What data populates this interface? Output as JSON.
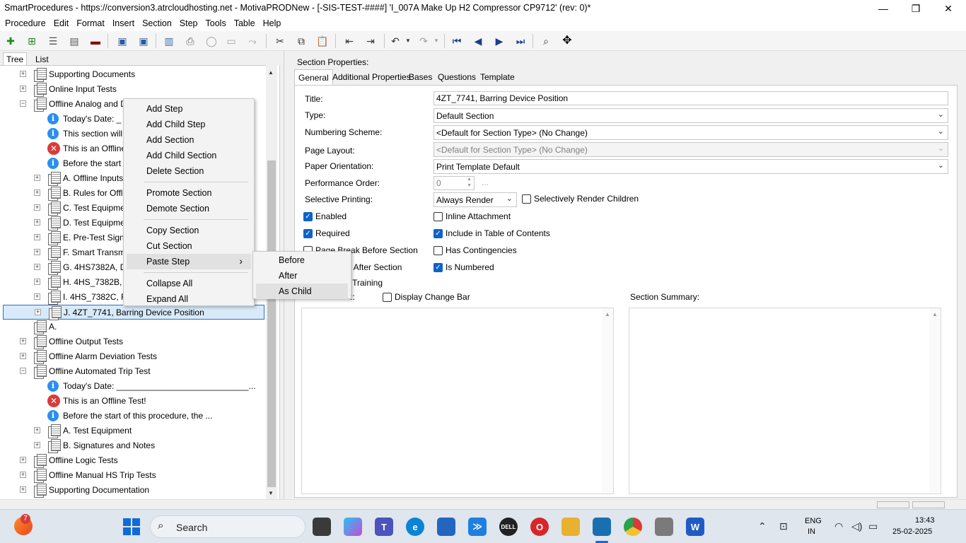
{
  "window": {
    "title": "SmartProcedures - https://conversion3.atrcloudhosting.net - MotivaPRODNew - [-SIS-TEST-####] 'I_007A Make Up H2 Compressor CP9712' (rev: 0)*",
    "minimize": "—",
    "maximize": "❐",
    "close": "✕"
  },
  "menu": [
    "Procedure",
    "Edit",
    "Format",
    "Insert",
    "Section",
    "Step",
    "Tools",
    "Table",
    "Help"
  ],
  "left_tabs": [
    "Tree",
    "List"
  ],
  "tree": [
    {
      "label": "Supporting Documents",
      "kind": "doc",
      "exp": "+",
      "indent": 0
    },
    {
      "label": "Online Input Tests",
      "kind": "doc",
      "exp": "+",
      "indent": 0
    },
    {
      "label": "Offline Analog and D",
      "kind": "doc",
      "exp": "−",
      "indent": 0
    },
    {
      "label": "Today's Date: _",
      "kind": "info",
      "exp": "",
      "indent": 1
    },
    {
      "label": "This section will b",
      "kind": "info",
      "exp": "",
      "indent": 1
    },
    {
      "label": "This is an Offline",
      "kind": "error",
      "exp": "",
      "indent": 1
    },
    {
      "label": "Before the start",
      "kind": "info",
      "exp": "",
      "indent": 1
    },
    {
      "label": "A. Offline Inputs",
      "kind": "doc",
      "exp": "+",
      "indent": 1
    },
    {
      "label": "B. Rules for Offli",
      "kind": "doc",
      "exp": "+",
      "indent": 1
    },
    {
      "label": "C. Test Equipme",
      "kind": "doc",
      "exp": "+",
      "indent": 1
    },
    {
      "label": "D. Test Equipme",
      "kind": "doc",
      "exp": "+",
      "indent": 1
    },
    {
      "label": "E. Pre-Test Sign",
      "kind": "doc",
      "exp": "+",
      "indent": 1
    },
    {
      "label": "F. Smart Transm",
      "kind": "doc",
      "exp": "+",
      "indent": 1
    },
    {
      "label": "G. 4HS7382A, D",
      "kind": "doc",
      "exp": "+",
      "indent": 1
    },
    {
      "label": "H. 4HS_7382B, (",
      "kind": "doc",
      "exp": "+",
      "indent": 1
    },
    {
      "label": "I. 4HS_7382C, F",
      "kind": "doc",
      "exp": "+",
      "indent": 1
    },
    {
      "label": "J. 4ZT_7741, Barring Device Position",
      "kind": "doc",
      "exp": "+",
      "indent": 1,
      "selected": true
    },
    {
      "label": "A.",
      "kind": "doc",
      "exp": "",
      "indent": 0
    },
    {
      "label": "Offline Output Tests",
      "kind": "doc",
      "exp": "+",
      "indent": 0
    },
    {
      "label": "Offline Alarm Deviation Tests",
      "kind": "doc",
      "exp": "+",
      "indent": 0
    },
    {
      "label": "Offline Automated Trip Test",
      "kind": "doc",
      "exp": "−",
      "indent": 0
    },
    {
      "label": "Today's Date: ____________________________...",
      "kind": "info",
      "exp": "",
      "indent": 1
    },
    {
      "label": "This is an Offline Test!",
      "kind": "error",
      "exp": "",
      "indent": 1
    },
    {
      "label": "Before the start of this procedure, the ...",
      "kind": "info",
      "exp": "",
      "indent": 1
    },
    {
      "label": "A. Test Equipment",
      "kind": "doc",
      "exp": "+",
      "indent": 1
    },
    {
      "label": "B. Signatures and Notes",
      "kind": "doc",
      "exp": "+",
      "indent": 1
    },
    {
      "label": "Offline Logic Tests",
      "kind": "doc",
      "exp": "+",
      "indent": 0
    },
    {
      "label": "Offline Manual HS Trip Tests",
      "kind": "doc",
      "exp": "+",
      "indent": 0
    },
    {
      "label": "Supporting Documentation",
      "kind": "doc",
      "exp": "+",
      "indent": 0
    }
  ],
  "context_menu": {
    "items": [
      {
        "label": "Add Step"
      },
      {
        "label": "Add Child Step"
      },
      {
        "label": "Add Section"
      },
      {
        "label": "Add Child Section"
      },
      {
        "label": "Delete Section"
      },
      {
        "sep": true
      },
      {
        "label": "Promote Section"
      },
      {
        "label": "Demote Section"
      },
      {
        "sep": true
      },
      {
        "label": "Copy Section"
      },
      {
        "label": "Cut Section"
      },
      {
        "label": "Paste Step",
        "submenu": true,
        "highlighted": true
      },
      {
        "sep": true
      },
      {
        "label": "Collapse All"
      },
      {
        "label": "Expand All"
      }
    ],
    "submenu_arrow": "›",
    "submenu": [
      {
        "label": "Before"
      },
      {
        "label": "After"
      },
      {
        "label": "As Child",
        "highlighted": true
      }
    ]
  },
  "section_properties": {
    "heading": "Section Properties:",
    "tabs": [
      "General",
      "Additional Properties",
      "Bases",
      "Questions",
      "Template"
    ],
    "title_label": "Title:",
    "title_value": "4ZT_7741, Barring Device Position",
    "type_label": "Type:",
    "type_value": "Default Section",
    "numbering_label": "Numbering Scheme:",
    "numbering_value": "<Default for Section Type> (No Change)",
    "layout_label": "Page Layout:",
    "layout_value": "<Default for Section Type> (No Change)",
    "orientation_label": "Paper Orientation:",
    "orientation_value": "Print Template Default",
    "perf_label": "Performance Order:",
    "perf_value": "0",
    "perf_btn": "...",
    "selective_label": "Selective Printing:",
    "selective_value": "Always Render",
    "selective_children": "Selectively Render Children",
    "checkboxes_left": [
      {
        "label": "Enabled",
        "checked": true
      },
      {
        "label": "Required",
        "checked": true
      },
      {
        "label": "Page Break Before Section",
        "checked": false
      },
      {
        "label": "k After Section",
        "checked": false
      },
      {
        "label": "r Training",
        "checked": false
      }
    ],
    "checkboxes_right": [
      {
        "label": "Inline Attachment",
        "checked": false
      },
      {
        "label": "Include in Table of Contents",
        "checked": true
      },
      {
        "label": "Has Contingencies",
        "checked": false
      },
      {
        "label": "Is Numbered",
        "checked": true
      }
    ],
    "partial_label": "::",
    "display_change_bar": "Display Change Bar",
    "summary_label": "Section Summary:"
  },
  "taskbar": {
    "search": "Search",
    "notification_count": "7",
    "lang_top": "ENG",
    "lang_bottom": "IN",
    "time": "13:43",
    "date": "25-02-2025"
  },
  "colors": {
    "selection": "#cce4f7",
    "accent": "#0f63c8",
    "info": "#2a8ff0",
    "error": "#d83b3b"
  }
}
